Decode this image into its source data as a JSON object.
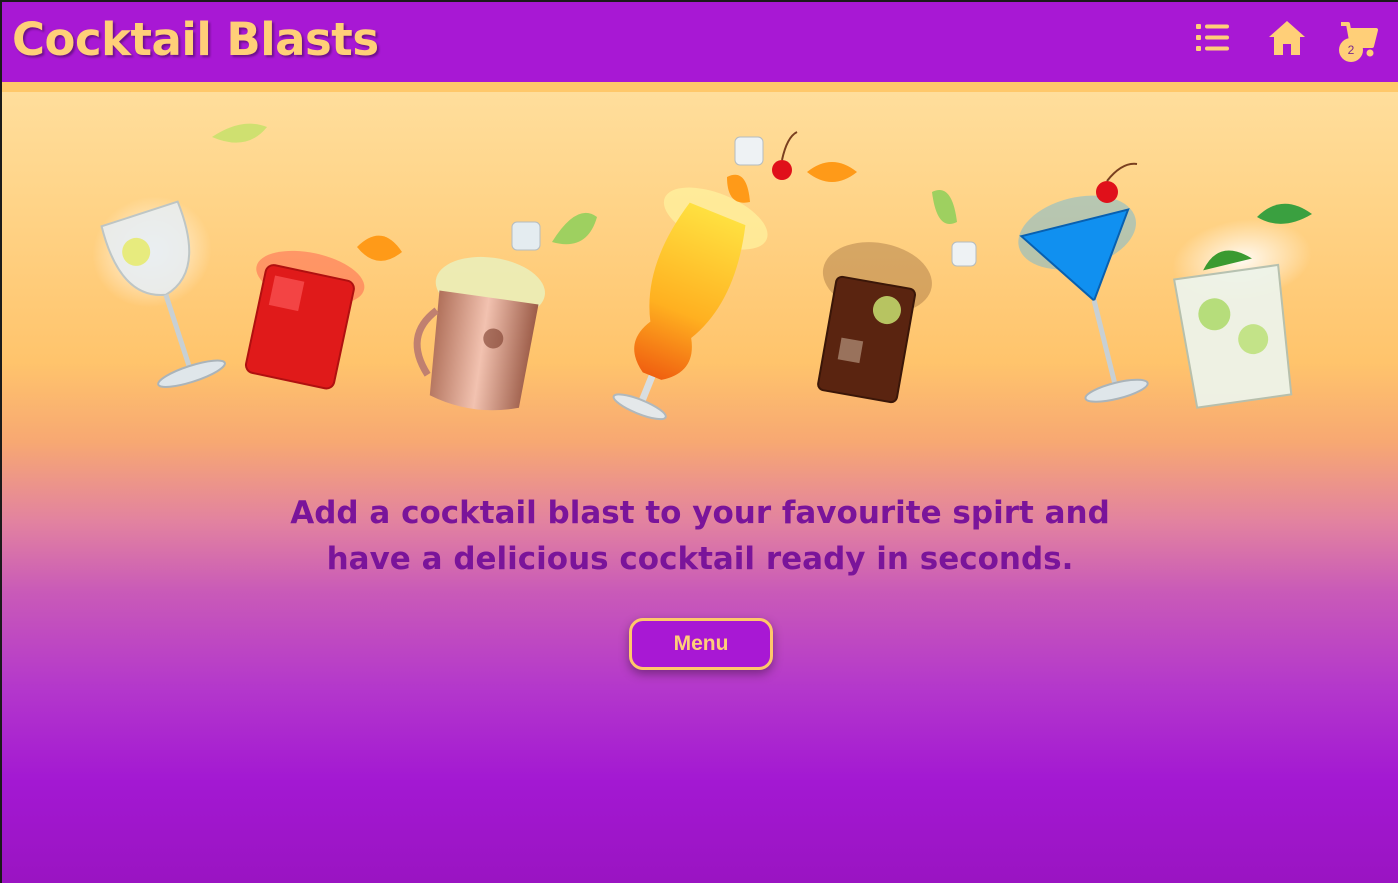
{
  "navbar": {
    "brand": "Cocktail Blasts",
    "cart_count": "2",
    "icons": [
      "list-icon",
      "home-icon",
      "cart-icon"
    ],
    "bg_color": "#a818d4",
    "accent_color": "#ffcf78"
  },
  "hero": {
    "drinks": [
      "gin-tonic-glass",
      "red-spritz-glass",
      "moscow-mule-mug",
      "tequila-sunrise-glass",
      "cola-glass",
      "blue-martini-glass",
      "mojito-glass"
    ]
  },
  "main": {
    "tagline_line1": "Add a cocktail blast to your favourite spirt and",
    "tagline_line2": "have a delicious cocktail ready in seconds.",
    "menu_button": "Menu"
  }
}
